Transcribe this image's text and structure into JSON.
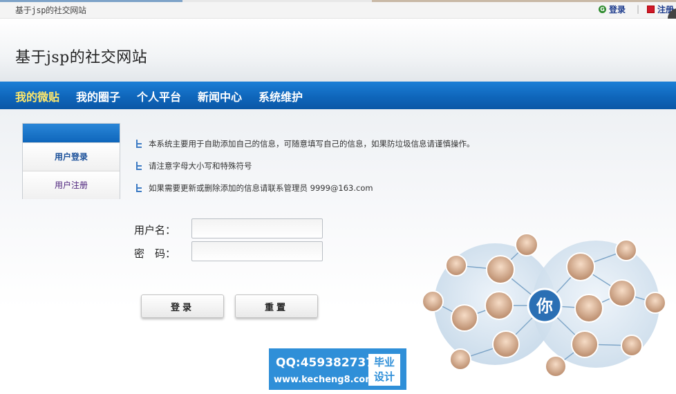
{
  "topbar": {
    "title": "基于jsp的社交网站",
    "login_label": "登录",
    "register_label": "注册"
  },
  "header": {
    "site_title": "基于jsp的社交网站"
  },
  "nav": {
    "items": [
      {
        "label": "我的微贴",
        "active": true
      },
      {
        "label": "我的圈子"
      },
      {
        "label": "个人平台"
      },
      {
        "label": "新闻中心"
      },
      {
        "label": "系统维护"
      }
    ]
  },
  "sidebar": {
    "items": [
      {
        "label": "用户登录"
      },
      {
        "label": "用户注册"
      }
    ]
  },
  "notes": [
    "本系统主要用于自助添加自己的信息，可随意填写自己的信息，如果防垃圾信息请谨慎操作。",
    "请注意字母大小写和特殊符号",
    "如果需要更新或删除添加的信息请联系管理员 9999@163.com"
  ],
  "form": {
    "username_label": "用户名：",
    "password_label": "密　码：",
    "username_value": "",
    "password_value": "",
    "login_button": "登录",
    "reset_button": "重置"
  },
  "illustration": {
    "center_label": "你"
  },
  "watermark": {
    "qq": "QQ:459382737",
    "url": "www.kecheng8.com",
    "box_line1": "毕业",
    "box_line2": "设计"
  },
  "colors": {
    "nav_blue": "#0f66bb",
    "nav_active_text": "#ffe86b",
    "link_blue": "#1d3b8c",
    "watermark_blue": "#2f8fd8"
  }
}
